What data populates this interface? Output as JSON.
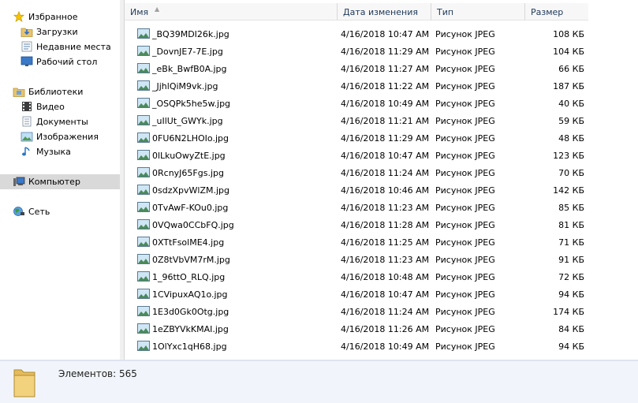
{
  "nav": {
    "favorites": {
      "label": "Избранное",
      "icon": "star-icon"
    },
    "favorites_items": [
      {
        "label": "Загрузки",
        "icon": "downloads-folder-icon"
      },
      {
        "label": "Недавние места",
        "icon": "recent-places-icon"
      },
      {
        "label": "Рабочий стол",
        "icon": "desktop-icon"
      }
    ],
    "libraries": {
      "label": "Библиотеки",
      "icon": "libraries-icon"
    },
    "libraries_items": [
      {
        "label": "Видео",
        "icon": "video-library-icon"
      },
      {
        "label": "Документы",
        "icon": "documents-library-icon"
      },
      {
        "label": "Изображения",
        "icon": "pictures-library-icon"
      },
      {
        "label": "Музыка",
        "icon": "music-library-icon"
      }
    ],
    "computer": {
      "label": "Компьютер",
      "icon": "computer-icon",
      "selected": true
    },
    "network": {
      "label": "Сеть",
      "icon": "network-icon"
    }
  },
  "columns": {
    "name": "Имя",
    "date": "Дата изменения",
    "type": "Тип",
    "size": "Размер",
    "sorted_by": "name"
  },
  "files": [
    {
      "name": "_BQ39MDI26k.jpg",
      "date": "4/16/2018 10:47 AM",
      "type": "Рисунок JPEG",
      "size": "108 КБ"
    },
    {
      "name": "_DovnJE7-7E.jpg",
      "date": "4/16/2018 11:29 AM",
      "type": "Рисунок JPEG",
      "size": "104 КБ"
    },
    {
      "name": "_eBk_BwfB0A.jpg",
      "date": "4/16/2018 11:27 AM",
      "type": "Рисунок JPEG",
      "size": "66 КБ"
    },
    {
      "name": "_JjhlQiM9vk.jpg",
      "date": "4/16/2018 11:22 AM",
      "type": "Рисунок JPEG",
      "size": "187 КБ"
    },
    {
      "name": "_OSQPk5he5w.jpg",
      "date": "4/16/2018 10:49 AM",
      "type": "Рисунок JPEG",
      "size": "40 КБ"
    },
    {
      "name": "_uIlUt_GWYk.jpg",
      "date": "4/16/2018 11:21 AM",
      "type": "Рисунок JPEG",
      "size": "59 КБ"
    },
    {
      "name": "0FU6N2LHOIo.jpg",
      "date": "4/16/2018 11:29 AM",
      "type": "Рисунок JPEG",
      "size": "48 КБ"
    },
    {
      "name": "0lLkuOwyZtE.jpg",
      "date": "4/16/2018 10:47 AM",
      "type": "Рисунок JPEG",
      "size": "123 КБ"
    },
    {
      "name": "0RcnyJ65Fgs.jpg",
      "date": "4/16/2018 11:24 AM",
      "type": "Рисунок JPEG",
      "size": "70 КБ"
    },
    {
      "name": "0sdzXpvWlZM.jpg",
      "date": "4/16/2018 10:46 AM",
      "type": "Рисунок JPEG",
      "size": "142 КБ"
    },
    {
      "name": "0TvAwF-KOu0.jpg",
      "date": "4/16/2018 11:23 AM",
      "type": "Рисунок JPEG",
      "size": "85 КБ"
    },
    {
      "name": "0VQwa0CCbFQ.jpg",
      "date": "4/16/2018 11:28 AM",
      "type": "Рисунок JPEG",
      "size": "81 КБ"
    },
    {
      "name": "0XTtFsolME4.jpg",
      "date": "4/16/2018 11:25 AM",
      "type": "Рисунок JPEG",
      "size": "71 КБ"
    },
    {
      "name": "0Z8tVbVM7rM.jpg",
      "date": "4/16/2018 11:23 AM",
      "type": "Рисунок JPEG",
      "size": "91 КБ"
    },
    {
      "name": "1_96ttO_RLQ.jpg",
      "date": "4/16/2018 10:48 AM",
      "type": "Рисунок JPEG",
      "size": "72 КБ"
    },
    {
      "name": "1CVipuxAQ1o.jpg",
      "date": "4/16/2018 10:47 AM",
      "type": "Рисунок JPEG",
      "size": "94 КБ"
    },
    {
      "name": "1E3d0Gk0Otg.jpg",
      "date": "4/16/2018 11:24 AM",
      "type": "Рисунок JPEG",
      "size": "174 КБ"
    },
    {
      "name": "1eZBYVkKMAI.jpg",
      "date": "4/16/2018 11:26 AM",
      "type": "Рисунок JPEG",
      "size": "84 КБ"
    },
    {
      "name": "1OlYxc1qH68.jpg",
      "date": "4/16/2018 10:49 AM",
      "type": "Рисунок JPEG",
      "size": "94 КБ"
    }
  ],
  "details": {
    "count_text": "Элементов: 565",
    "icon": "folder-icon"
  },
  "colors": {
    "selected_nav_bg": "#d9d9d9",
    "header_text": "#1e395b",
    "details_bg": "#f1f5fb"
  }
}
